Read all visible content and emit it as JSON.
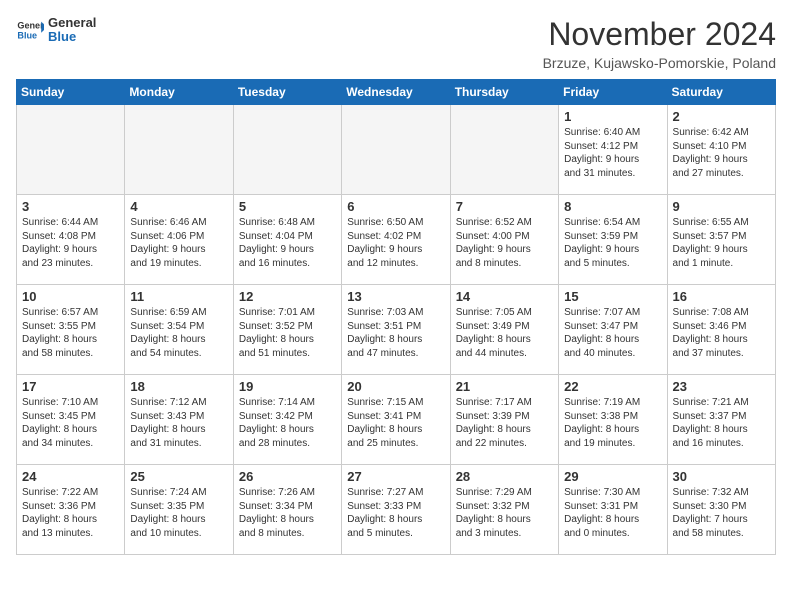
{
  "header": {
    "logo_general": "General",
    "logo_blue": "Blue",
    "month_title": "November 2024",
    "location": "Brzuze, Kujawsko-Pomorskie, Poland"
  },
  "weekdays": [
    "Sunday",
    "Monday",
    "Tuesday",
    "Wednesday",
    "Thursday",
    "Friday",
    "Saturday"
  ],
  "weeks": [
    [
      {
        "day": "",
        "info": ""
      },
      {
        "day": "",
        "info": ""
      },
      {
        "day": "",
        "info": ""
      },
      {
        "day": "",
        "info": ""
      },
      {
        "day": "",
        "info": ""
      },
      {
        "day": "1",
        "info": "Sunrise: 6:40 AM\nSunset: 4:12 PM\nDaylight: 9 hours\nand 31 minutes."
      },
      {
        "day": "2",
        "info": "Sunrise: 6:42 AM\nSunset: 4:10 PM\nDaylight: 9 hours\nand 27 minutes."
      }
    ],
    [
      {
        "day": "3",
        "info": "Sunrise: 6:44 AM\nSunset: 4:08 PM\nDaylight: 9 hours\nand 23 minutes."
      },
      {
        "day": "4",
        "info": "Sunrise: 6:46 AM\nSunset: 4:06 PM\nDaylight: 9 hours\nand 19 minutes."
      },
      {
        "day": "5",
        "info": "Sunrise: 6:48 AM\nSunset: 4:04 PM\nDaylight: 9 hours\nand 16 minutes."
      },
      {
        "day": "6",
        "info": "Sunrise: 6:50 AM\nSunset: 4:02 PM\nDaylight: 9 hours\nand 12 minutes."
      },
      {
        "day": "7",
        "info": "Sunrise: 6:52 AM\nSunset: 4:00 PM\nDaylight: 9 hours\nand 8 minutes."
      },
      {
        "day": "8",
        "info": "Sunrise: 6:54 AM\nSunset: 3:59 PM\nDaylight: 9 hours\nand 5 minutes."
      },
      {
        "day": "9",
        "info": "Sunrise: 6:55 AM\nSunset: 3:57 PM\nDaylight: 9 hours\nand 1 minute."
      }
    ],
    [
      {
        "day": "10",
        "info": "Sunrise: 6:57 AM\nSunset: 3:55 PM\nDaylight: 8 hours\nand 58 minutes."
      },
      {
        "day": "11",
        "info": "Sunrise: 6:59 AM\nSunset: 3:54 PM\nDaylight: 8 hours\nand 54 minutes."
      },
      {
        "day": "12",
        "info": "Sunrise: 7:01 AM\nSunset: 3:52 PM\nDaylight: 8 hours\nand 51 minutes."
      },
      {
        "day": "13",
        "info": "Sunrise: 7:03 AM\nSunset: 3:51 PM\nDaylight: 8 hours\nand 47 minutes."
      },
      {
        "day": "14",
        "info": "Sunrise: 7:05 AM\nSunset: 3:49 PM\nDaylight: 8 hours\nand 44 minutes."
      },
      {
        "day": "15",
        "info": "Sunrise: 7:07 AM\nSunset: 3:47 PM\nDaylight: 8 hours\nand 40 minutes."
      },
      {
        "day": "16",
        "info": "Sunrise: 7:08 AM\nSunset: 3:46 PM\nDaylight: 8 hours\nand 37 minutes."
      }
    ],
    [
      {
        "day": "17",
        "info": "Sunrise: 7:10 AM\nSunset: 3:45 PM\nDaylight: 8 hours\nand 34 minutes."
      },
      {
        "day": "18",
        "info": "Sunrise: 7:12 AM\nSunset: 3:43 PM\nDaylight: 8 hours\nand 31 minutes."
      },
      {
        "day": "19",
        "info": "Sunrise: 7:14 AM\nSunset: 3:42 PM\nDaylight: 8 hours\nand 28 minutes."
      },
      {
        "day": "20",
        "info": "Sunrise: 7:15 AM\nSunset: 3:41 PM\nDaylight: 8 hours\nand 25 minutes."
      },
      {
        "day": "21",
        "info": "Sunrise: 7:17 AM\nSunset: 3:39 PM\nDaylight: 8 hours\nand 22 minutes."
      },
      {
        "day": "22",
        "info": "Sunrise: 7:19 AM\nSunset: 3:38 PM\nDaylight: 8 hours\nand 19 minutes."
      },
      {
        "day": "23",
        "info": "Sunrise: 7:21 AM\nSunset: 3:37 PM\nDaylight: 8 hours\nand 16 minutes."
      }
    ],
    [
      {
        "day": "24",
        "info": "Sunrise: 7:22 AM\nSunset: 3:36 PM\nDaylight: 8 hours\nand 13 minutes."
      },
      {
        "day": "25",
        "info": "Sunrise: 7:24 AM\nSunset: 3:35 PM\nDaylight: 8 hours\nand 10 minutes."
      },
      {
        "day": "26",
        "info": "Sunrise: 7:26 AM\nSunset: 3:34 PM\nDaylight: 8 hours\nand 8 minutes."
      },
      {
        "day": "27",
        "info": "Sunrise: 7:27 AM\nSunset: 3:33 PM\nDaylight: 8 hours\nand 5 minutes."
      },
      {
        "day": "28",
        "info": "Sunrise: 7:29 AM\nSunset: 3:32 PM\nDaylight: 8 hours\nand 3 minutes."
      },
      {
        "day": "29",
        "info": "Sunrise: 7:30 AM\nSunset: 3:31 PM\nDaylight: 8 hours\nand 0 minutes."
      },
      {
        "day": "30",
        "info": "Sunrise: 7:32 AM\nSunset: 3:30 PM\nDaylight: 7 hours\nand 58 minutes."
      }
    ]
  ]
}
